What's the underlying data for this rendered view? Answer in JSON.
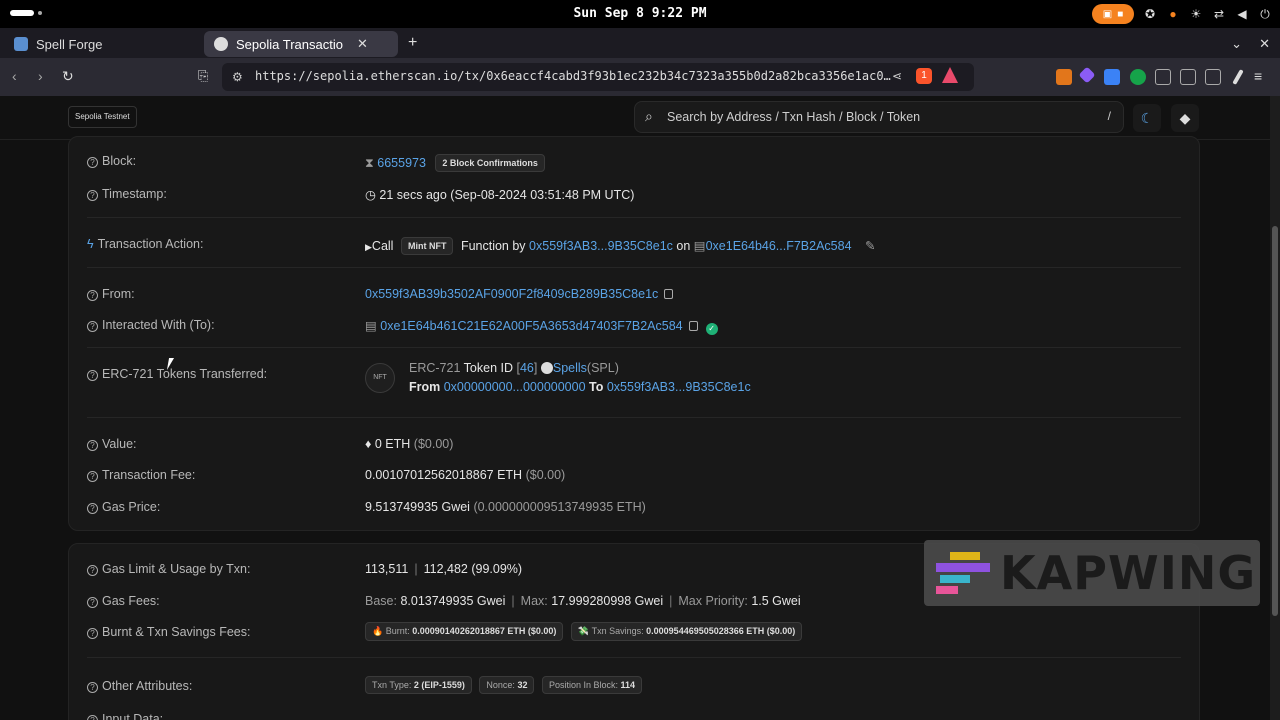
{
  "system": {
    "clock": "Sun Sep 8  9:22 PM"
  },
  "browser": {
    "tabs": [
      {
        "label": "Spell Forge",
        "active": false
      },
      {
        "label": "Sepolia Transactio",
        "active": true
      }
    ],
    "url": "https://sepolia.etherscan.io/tx/0x6eaccf4cabd3f93b1ec232b34c7323a355b0d2a82bca3356e1ac0…",
    "brave_count": "1"
  },
  "header": {
    "network_badge": "Sepolia Testnet",
    "search_placeholder": "Search by Address / Txn Hash / Block / Token",
    "search_shortcut": "/"
  },
  "tx": {
    "block": {
      "label": "Block:",
      "number": "6655973",
      "confirmations": "2 Block Confirmations"
    },
    "timestamp": {
      "label": "Timestamp:",
      "value": "21 secs ago (Sep-08-2024 03:51:48 PM UTC)"
    },
    "action": {
      "label": "Transaction Action:",
      "call": "Call",
      "method": "Mint NFT",
      "function_by": "Function by",
      "caller": "0x559f3AB3...9B35C8e1c",
      "on": "on",
      "contract": "0xe1E64b46...F7B2Ac584"
    },
    "from": {
      "label": "From:",
      "address": "0x559f3AB39b3502AF0900F2f8409cB289B35C8e1c"
    },
    "to": {
      "label": "Interacted With (To):",
      "address": "0xe1E64b461C21E62A00F5A3653d47403F7B2Ac584"
    },
    "erc721": {
      "label": "ERC-721 Tokens Transferred:",
      "standard": "ERC-721",
      "token_id_label": "Token ID",
      "token_id": "46",
      "token_name": "Spells",
      "token_symbol": "(SPL)",
      "from_label": "From",
      "from": "0x00000000...000000000",
      "to_label": "To",
      "to": "0x559f3AB3...9B35C8e1c",
      "nft_icon_text": "NFT"
    },
    "value": {
      "label": "Value:",
      "amount": "0 ETH",
      "usd": "($0.00)"
    },
    "fee": {
      "label": "Transaction Fee:",
      "amount": "0.00107012562018867 ETH",
      "usd": "($0.00)"
    },
    "gas_price": {
      "label": "Gas Price:",
      "amount": "9.513749935 Gwei",
      "eth": "(0.000000009513749935 ETH)"
    }
  },
  "gas": {
    "limit": {
      "label": "Gas Limit & Usage by Txn:",
      "limit": "113,511",
      "usage": "112,482 (99.09%)"
    },
    "fees": {
      "label": "Gas Fees:",
      "base_label": "Base:",
      "base": "8.013749935 Gwei",
      "max_label": "Max:",
      "max": "17.999280998 Gwei",
      "priority_label": "Max Priority:",
      "priority": "1.5 Gwei"
    },
    "burnt": {
      "label": "Burnt & Txn Savings Fees:",
      "burnt_label": "Burnt:",
      "burnt": "0.00090140262018867 ETH ($0.00)",
      "savings_label": "Txn Savings:",
      "savings": "0.000954469505028366 ETH ($0.00)"
    },
    "other": {
      "label": "Other Attributes:",
      "type_label": "Txn Type:",
      "type": "2 (EIP-1559)",
      "nonce_label": "Nonce:",
      "nonce": "32",
      "position_label": "Position In Block:",
      "position": "114"
    },
    "input": {
      "label": "Input Data:"
    }
  },
  "watermark": {
    "text": "KAPWING"
  },
  "colors": {
    "link": "#5aa3e6",
    "verified": "#1fb176",
    "record": "#f5821f"
  }
}
